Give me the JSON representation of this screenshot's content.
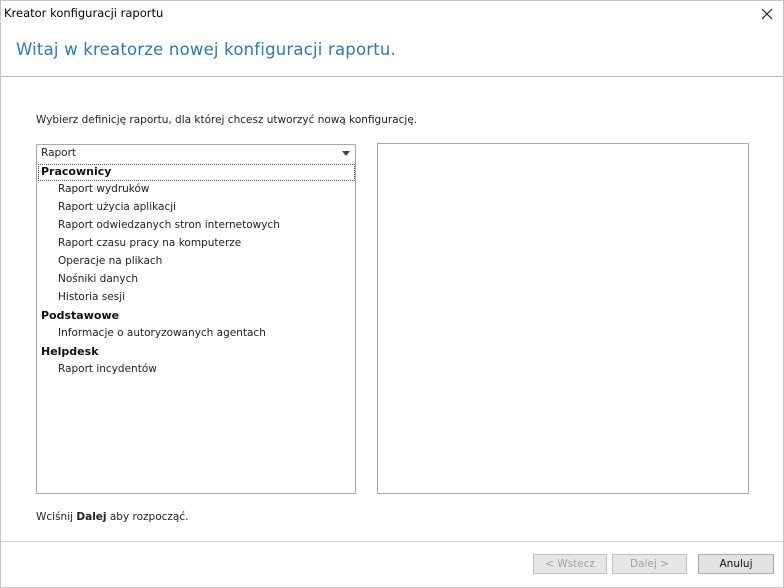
{
  "window": {
    "title": "Kreator konfiguracji raportu"
  },
  "header": {
    "title": "Witaj w kreatorze nowej konfiguracji raportu."
  },
  "instruction": "Wybierz definicję raportu, dla której chcesz utworzyć nową konfigurację.",
  "combo": {
    "value": "Raport"
  },
  "list": {
    "groups": [
      {
        "label": "Pracownicy",
        "items": [
          "Raport wydruków",
          "Raport użycia aplikacji",
          "Raport odwiedzanych stron internetowych",
          "Raport czasu pracy na komputerze",
          "Operacje na plikach",
          "Nośniki danych",
          "Historia sesji"
        ]
      },
      {
        "label": "Podstawowe",
        "items": [
          "Informacje o autoryzowanych agentach"
        ]
      },
      {
        "label": "Helpdesk",
        "items": [
          "Raport incydentów"
        ]
      }
    ]
  },
  "footer": {
    "hint_prefix": "Wciśnij",
    "hint_bold": "Dalej",
    "hint_suffix": "aby rozpocząć."
  },
  "buttons": {
    "back": "< Wstecz",
    "next": "Dalej >",
    "cancel": "Anuluj"
  },
  "icons": {
    "close": "close-icon",
    "dropdown": "chevron-down-icon"
  },
  "colors": {
    "header_title": "#2b79b5"
  }
}
